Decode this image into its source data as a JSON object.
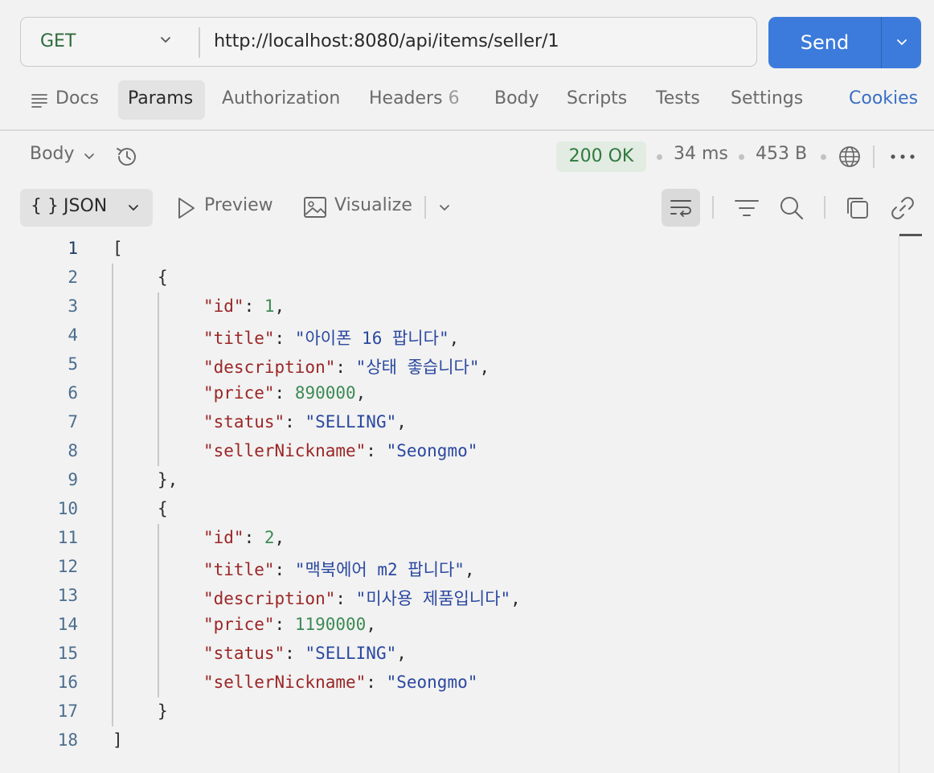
{
  "request": {
    "method": "GET",
    "url": "http://localhost:8080/api/items/seller/1",
    "send_label": "Send"
  },
  "tabs": [
    {
      "label": "Docs",
      "icon": "docs-lines-icon"
    },
    {
      "label": "Params",
      "active": true
    },
    {
      "label": "Authorization"
    },
    {
      "label": "Headers",
      "count": "6"
    },
    {
      "label": "Body"
    },
    {
      "label": "Scripts"
    },
    {
      "label": "Tests"
    },
    {
      "label": "Settings"
    }
  ],
  "cookies_label": "Cookies",
  "response": {
    "body_label": "Body",
    "status": "200 OK",
    "time": "34 ms",
    "size": "453 B",
    "colors": {
      "status_bg": "#e2ece2",
      "status_fg": "#2f7a3d",
      "accent": "#3c7bdb"
    }
  },
  "toolbar": {
    "format_label": "JSON",
    "format_icon": "{ }",
    "preview_label": "Preview",
    "visualize_label": "Visualize"
  },
  "code": {
    "line_numbers": [
      "1",
      "2",
      "3",
      "4",
      "5",
      "6",
      "7",
      "8",
      "9",
      "10",
      "11",
      "12",
      "13",
      "14",
      "15",
      "16",
      "17",
      "18"
    ],
    "items": [
      {
        "id": "1",
        "title": "\"아이폰 16 팝니다\"",
        "description": "\"상태 좋습니다\"",
        "price": "890000",
        "status": "\"SELLING\"",
        "sellerNickname": "\"Seongmo\""
      },
      {
        "id": "2",
        "title": "\"맥북에어 m2 팝니다\"",
        "description": "\"미사용 제품입니다\"",
        "price": "1190000",
        "status": "\"SELLING\"",
        "sellerNickname": "\"Seongmo\""
      }
    ],
    "keys": {
      "id": "\"id\"",
      "title": "\"title\"",
      "description": "\"description\"",
      "price": "\"price\"",
      "status": "\"status\"",
      "sellerNickname": "\"sellerNickname\""
    }
  }
}
